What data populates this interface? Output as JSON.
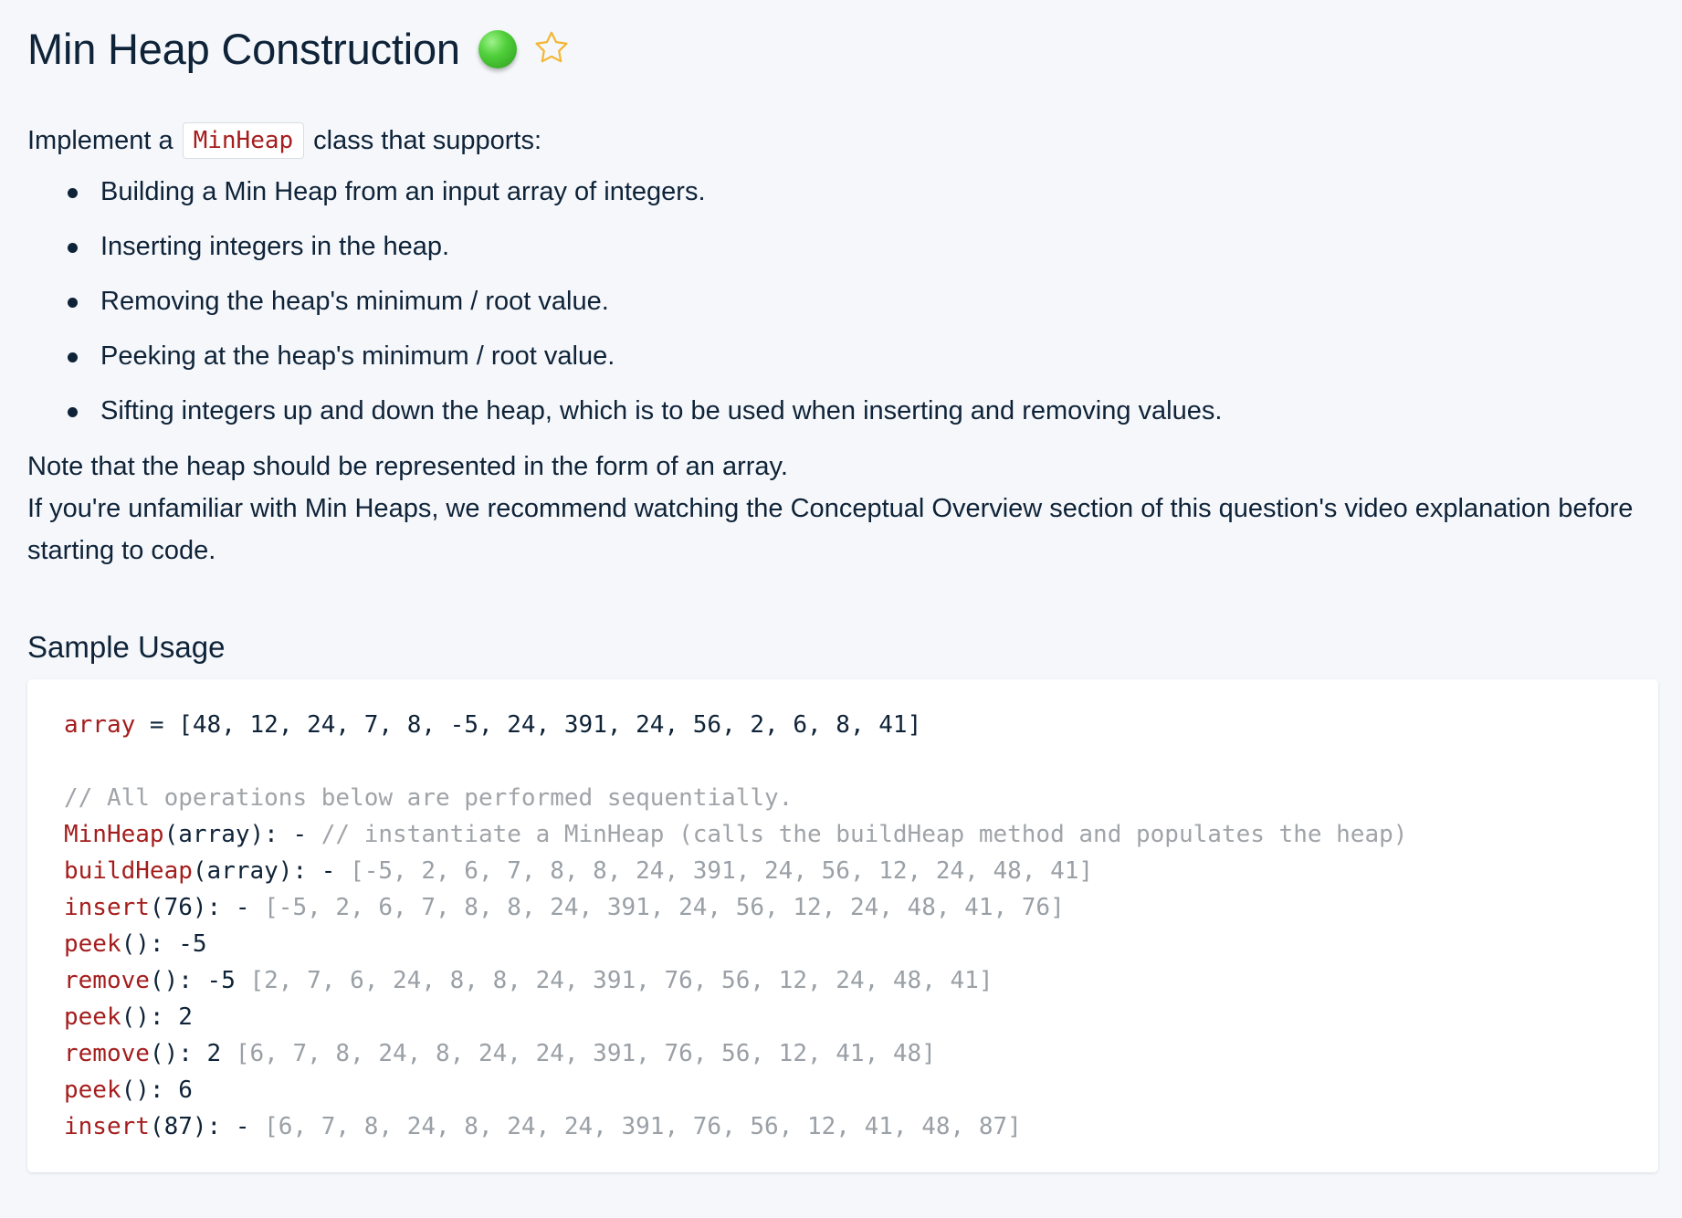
{
  "header": {
    "title": "Min Heap Construction",
    "difficulty_color": "#4fcf3a",
    "favorite_icon": "star-outline-icon"
  },
  "description": {
    "intro_before": "Implement a",
    "intro_code": "MinHeap",
    "intro_after": "class that supports:",
    "bullets": [
      "Building a Min Heap from an input array of integers.",
      "Inserting integers in the heap.",
      "Removing the heap's minimum / root value.",
      "Peeking at the heap's minimum / root value.",
      "Sifting integers up and down the heap, which is to be used when inserting and removing values."
    ],
    "note": "Note that the heap should be represented in the form of an array.",
    "recommendation": "If you're unfamiliar with Min Heaps, we recommend watching the Conceptual Overview section of this question's video explanation before starting to code."
  },
  "sample": {
    "heading": "Sample Usage",
    "array_line": {
      "name": "array",
      "op": " = ",
      "value": "[48, 12, 24, 7, 8, -5, 24, 391, 24, 56, 2, 6, 8, 41]"
    },
    "comment": "// All operations below are performed sequentially.",
    "operations": [
      {
        "fn": "MinHeap",
        "args": "(array): - ",
        "result": "// instantiate a MinHeap (calls the buildHeap method and populates the heap)"
      },
      {
        "fn": "buildHeap",
        "args": "(array): - ",
        "result": "[-5, 2, 6, 7, 8, 8, 24, 391, 24, 56, 12, 24, 48, 41]"
      },
      {
        "fn": "insert",
        "args": "(76): - ",
        "result": "[-5, 2, 6, 7, 8, 8, 24, 391, 24, 56, 12, 24, 48, 41, 76]"
      },
      {
        "fn": "peek",
        "args": "(): -5",
        "result": ""
      },
      {
        "fn": "remove",
        "args": "(): -5 ",
        "result": "[2, 7, 6, 24, 8, 8, 24, 391, 76, 56, 12, 24, 48, 41]"
      },
      {
        "fn": "peek",
        "args": "(): 2",
        "result": ""
      },
      {
        "fn": "remove",
        "args": "(): 2 ",
        "result": "[6, 7, 8, 24, 8, 24, 24, 391, 76, 56, 12, 41, 48]"
      },
      {
        "fn": "peek",
        "args": "(): 6",
        "result": ""
      },
      {
        "fn": "insert",
        "args": "(87): - ",
        "result": "[6, 7, 8, 24, 8, 24, 24, 391, 76, 56, 12, 41, 48, 87]"
      }
    ]
  }
}
